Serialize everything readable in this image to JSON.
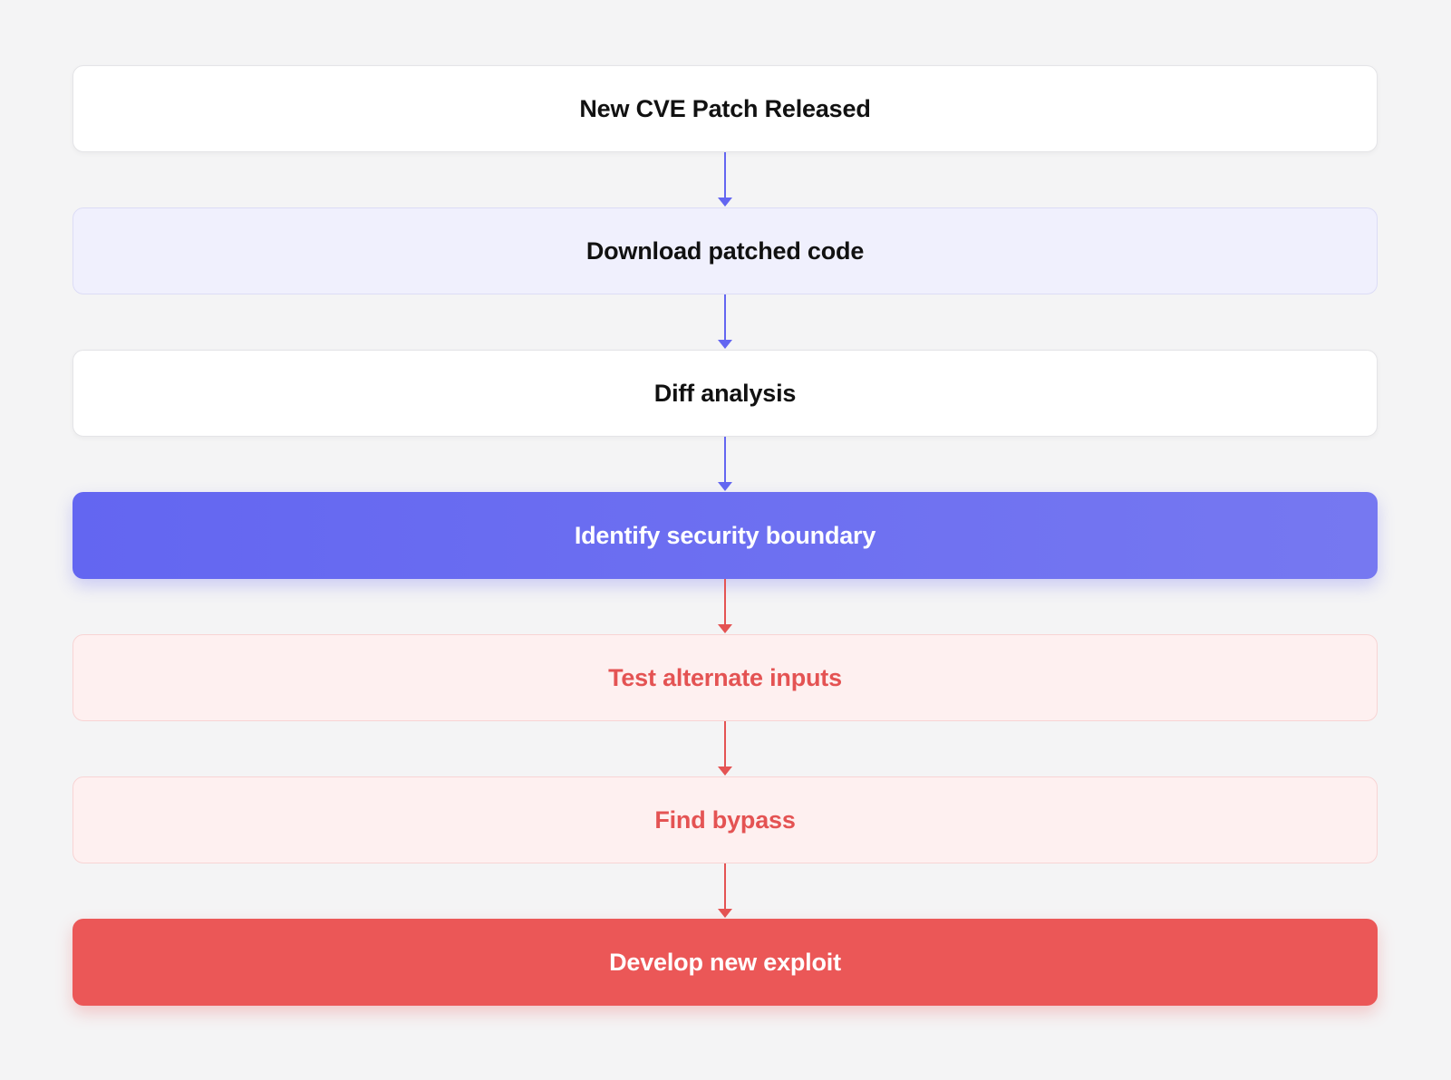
{
  "flow": {
    "steps": [
      {
        "label": "New CVE Patch Released"
      },
      {
        "label": "Download patched code"
      },
      {
        "label": "Diff analysis"
      },
      {
        "label": "Identify security boundary"
      },
      {
        "label": "Test alternate inputs"
      },
      {
        "label": "Find bypass"
      },
      {
        "label": "Develop new exploit"
      }
    ]
  },
  "colors": {
    "indigo": "#6366f1",
    "red": "#eb5757",
    "background": "#f4f4f5"
  }
}
